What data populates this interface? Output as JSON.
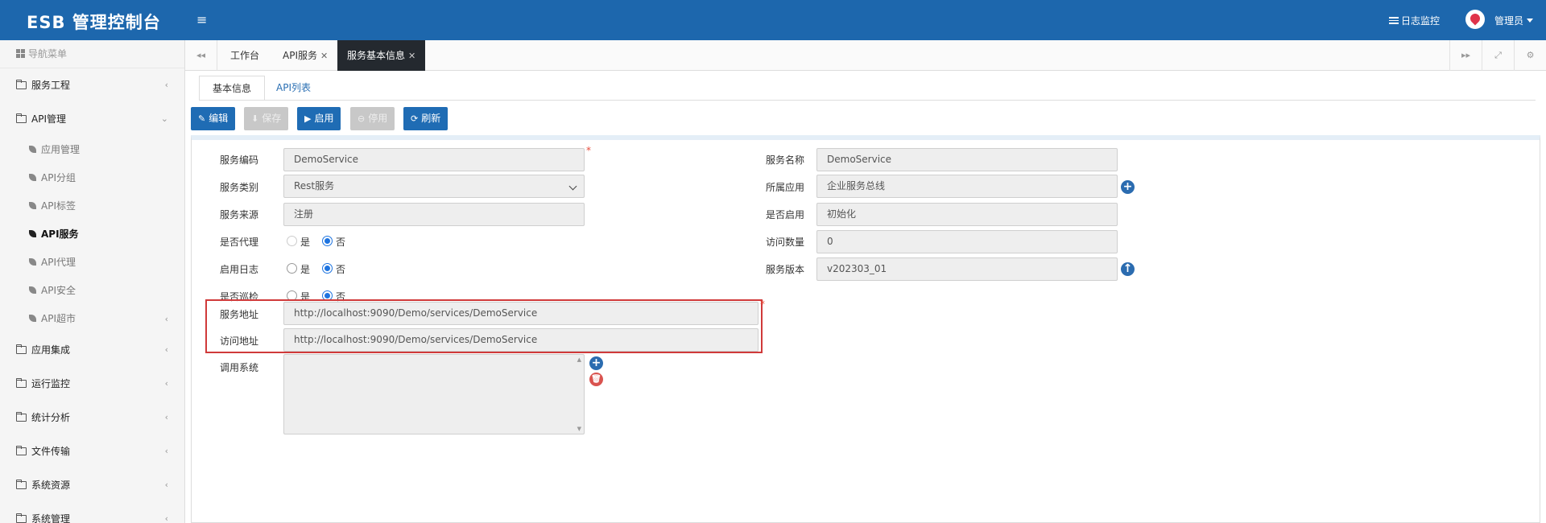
{
  "header": {
    "brand": "ESB 管理控制台",
    "menu_toggle": "≡",
    "log_monitor": "日志监控",
    "user_name": "管理员"
  },
  "sidebar": {
    "title": "导航菜单",
    "groups": [
      {
        "label": "服务工程",
        "chevron": "‹"
      },
      {
        "label": "API管理",
        "chevron": "⌄"
      },
      {
        "label": "应用集成",
        "chevron": "‹"
      },
      {
        "label": "运行监控",
        "chevron": "‹"
      },
      {
        "label": "统计分析",
        "chevron": "‹"
      },
      {
        "label": "文件传输",
        "chevron": "‹"
      },
      {
        "label": "系统资源",
        "chevron": "‹"
      },
      {
        "label": "系统管理",
        "chevron": "‹"
      }
    ],
    "api_items": [
      {
        "label": "应用管理"
      },
      {
        "label": "API分组"
      },
      {
        "label": "API标签"
      },
      {
        "label": "API服务"
      },
      {
        "label": "API代理"
      },
      {
        "label": "API安全"
      },
      {
        "label": "API超市",
        "chevron": "‹"
      }
    ]
  },
  "tabs": {
    "prev": "◂◂",
    "items": [
      {
        "label": "工作台"
      },
      {
        "label": "API服务",
        "close": "✕"
      },
      {
        "label": "服务基本信息",
        "close": "✕"
      }
    ],
    "next": "▸▸",
    "fullscreen": "⤢",
    "settings": "⚙"
  },
  "subtabs": [
    "基本信息",
    "API列表"
  ],
  "toolbar": {
    "edit": "编辑",
    "save": "保存",
    "enable": "启用",
    "disable": "停用",
    "refresh": "刷新",
    "edit_icon": "✎",
    "save_icon": "⬇",
    "enable_icon": "▶",
    "disable_icon": "⊖",
    "refresh_icon": "⟳"
  },
  "form": {
    "service_code_label": "服务编码",
    "service_code": "DemoService",
    "service_category_label": "服务类别",
    "service_category": "Rest服务",
    "service_source_label": "服务来源",
    "service_source": "注册",
    "is_proxy_label": "是否代理",
    "enable_log_label": "启用日志",
    "is_inspect_label": "是否巡检",
    "yes": "是",
    "no": "否",
    "service_address_label": "服务地址",
    "service_address": "http://localhost:9090/Demo/services/DemoService",
    "access_address_label": "访问地址",
    "access_address": "http://localhost:9090/Demo/services/DemoService",
    "calling_system_label": "调用系统",
    "service_name_label": "服务名称",
    "service_name": "DemoService",
    "app_label": "所属应用",
    "app": "企业服务总线",
    "is_enabled_label": "是否启用",
    "is_enabled": "初始化",
    "visit_count_label": "访问数量",
    "visit_count": "0",
    "version_label": "服务版本",
    "version": "v202303_01",
    "required_mark": "*",
    "add_icon": "+",
    "up_icon": "↑",
    "delete_icon": "🗑"
  },
  "colors": {
    "header": "#1d67ad",
    "primary_button": "#1f6cb4",
    "highlight_box": "#d03a3a",
    "radio_selected": "#1e74e0"
  }
}
